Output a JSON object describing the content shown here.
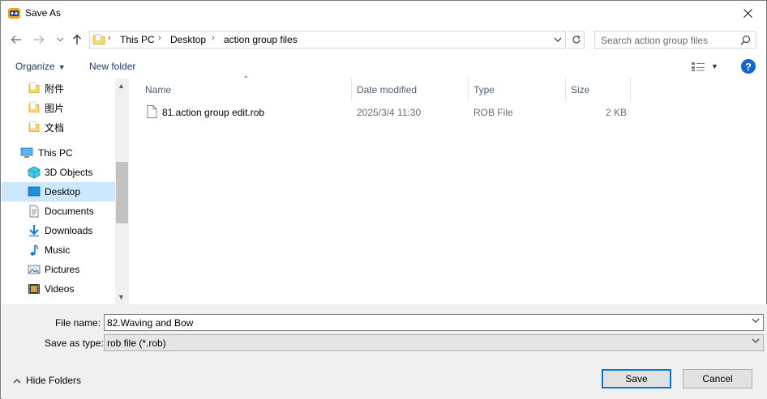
{
  "window": {
    "title": "Save As"
  },
  "nav": {
    "breadcrumbs": [
      "This PC",
      "Desktop",
      "action group files"
    ],
    "search_placeholder": "Search action group files"
  },
  "toolbar": {
    "organize_label": "Organize",
    "new_folder_label": "New folder"
  },
  "tree": {
    "items": [
      {
        "label": "附件",
        "icon": "folder-icon"
      },
      {
        "label": "图片",
        "icon": "folder-icon"
      },
      {
        "label": "文档",
        "icon": "folder-icon"
      },
      {
        "label": "This PC",
        "icon": "computer-icon"
      },
      {
        "label": "3D Objects",
        "icon": "cube-icon"
      },
      {
        "label": "Desktop",
        "icon": "desktop-icon",
        "selected": true
      },
      {
        "label": "Documents",
        "icon": "document-icon"
      },
      {
        "label": "Downloads",
        "icon": "download-icon"
      },
      {
        "label": "Music",
        "icon": "music-icon"
      },
      {
        "label": "Pictures",
        "icon": "pictures-icon"
      },
      {
        "label": "Videos",
        "icon": "video-icon"
      }
    ]
  },
  "filelist": {
    "columns": [
      "Name",
      "Date modified",
      "Type",
      "Size"
    ],
    "rows": [
      {
        "name": "81.action group edit.rob",
        "date": "2025/3/4 11:30",
        "type": "ROB File",
        "size": "2 KB"
      }
    ]
  },
  "form": {
    "file_name_label": "File name:",
    "file_name_value": "82.Waving and Bow",
    "save_type_label": "Save as type:",
    "save_type_value": "rob file (*.rob)"
  },
  "footer": {
    "hide_folders_label": "Hide Folders",
    "save_label": "Save",
    "cancel_label": "Cancel"
  },
  "colors": {
    "selection": "#cce8ff",
    "accent": "#0078d7",
    "help": "#1464c8"
  }
}
